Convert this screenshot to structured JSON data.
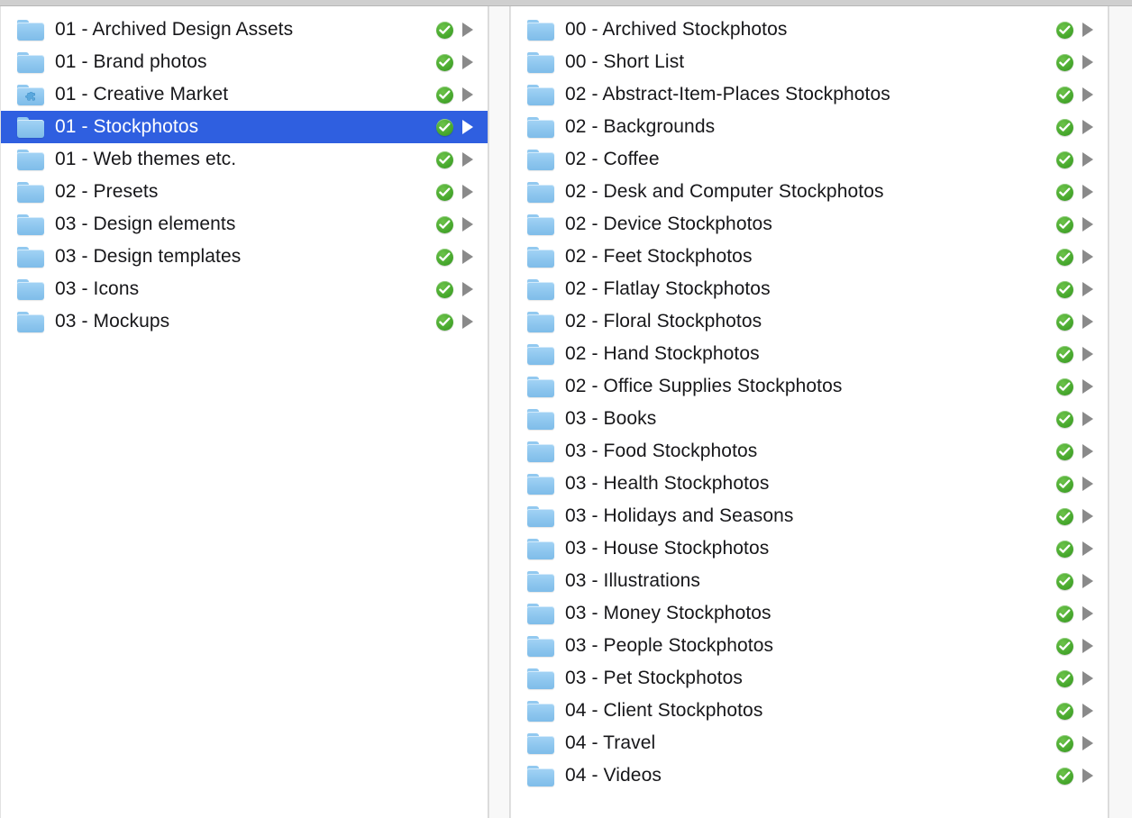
{
  "window": {
    "app": "Finder",
    "view_mode": "column-view",
    "accent_color": "#2f5fe0",
    "sync_badge_color": "#47a82d",
    "folder_color": "#8dc6ee",
    "text_color": "#17171a"
  },
  "icons": {
    "folder": "folder-icon",
    "folder_plugin": "folder-plugin-icon",
    "sync_ok": "dropbox-sync-check-icon",
    "disclosure": "disclosure-arrow-icon"
  },
  "columns": [
    {
      "name": "parent-column",
      "items": [
        {
          "label": "01 - Archived Design Assets",
          "icon": "folder",
          "synced": true,
          "has_children": true,
          "selected": false
        },
        {
          "label": "01 - Brand photos",
          "icon": "folder",
          "synced": true,
          "has_children": true,
          "selected": false
        },
        {
          "label": "01 - Creative Market",
          "icon": "folder-plugin",
          "synced": true,
          "has_children": true,
          "selected": false
        },
        {
          "label": "01 - Stockphotos",
          "icon": "folder",
          "synced": true,
          "has_children": true,
          "selected": true
        },
        {
          "label": "01 - Web themes etc.",
          "icon": "folder",
          "synced": true,
          "has_children": true,
          "selected": false
        },
        {
          "label": "02 - Presets",
          "icon": "folder",
          "synced": true,
          "has_children": true,
          "selected": false
        },
        {
          "label": "03 - Design elements",
          "icon": "folder",
          "synced": true,
          "has_children": true,
          "selected": false
        },
        {
          "label": "03 - Design templates",
          "icon": "folder",
          "synced": true,
          "has_children": true,
          "selected": false
        },
        {
          "label": "03 - Icons",
          "icon": "folder",
          "synced": true,
          "has_children": true,
          "selected": false
        },
        {
          "label": "03 - Mockups",
          "icon": "folder",
          "synced": true,
          "has_children": true,
          "selected": false
        }
      ]
    },
    {
      "name": "child-column",
      "items": [
        {
          "label": "00 - Archived Stockphotos",
          "icon": "folder",
          "synced": true,
          "has_children": true,
          "selected": false
        },
        {
          "label": "00 - Short List",
          "icon": "folder",
          "synced": true,
          "has_children": true,
          "selected": false
        },
        {
          "label": "02 - Abstract-Item-Places Stockphotos",
          "icon": "folder",
          "synced": true,
          "has_children": true,
          "selected": false
        },
        {
          "label": "02 - Backgrounds",
          "icon": "folder",
          "synced": true,
          "has_children": true,
          "selected": false
        },
        {
          "label": "02 - Coffee",
          "icon": "folder",
          "synced": true,
          "has_children": true,
          "selected": false
        },
        {
          "label": "02 - Desk and Computer Stockphotos",
          "icon": "folder",
          "synced": true,
          "has_children": true,
          "selected": false
        },
        {
          "label": "02 - Device Stockphotos",
          "icon": "folder",
          "synced": true,
          "has_children": true,
          "selected": false
        },
        {
          "label": "02 - Feet Stockphotos",
          "icon": "folder",
          "synced": true,
          "has_children": true,
          "selected": false
        },
        {
          "label": "02 - Flatlay Stockphotos",
          "icon": "folder",
          "synced": true,
          "has_children": true,
          "selected": false
        },
        {
          "label": "02 - Floral Stockphotos",
          "icon": "folder",
          "synced": true,
          "has_children": true,
          "selected": false
        },
        {
          "label": "02 - Hand Stockphotos",
          "icon": "folder",
          "synced": true,
          "has_children": true,
          "selected": false
        },
        {
          "label": "02 - Office Supplies Stockphotos",
          "icon": "folder",
          "synced": true,
          "has_children": true,
          "selected": false
        },
        {
          "label": "03 - Books",
          "icon": "folder",
          "synced": true,
          "has_children": true,
          "selected": false
        },
        {
          "label": "03 - Food Stockphotos",
          "icon": "folder",
          "synced": true,
          "has_children": true,
          "selected": false
        },
        {
          "label": "03 - Health Stockphotos",
          "icon": "folder",
          "synced": true,
          "has_children": true,
          "selected": false
        },
        {
          "label": "03 - Holidays and Seasons",
          "icon": "folder",
          "synced": true,
          "has_children": true,
          "selected": false
        },
        {
          "label": "03 - House Stockphotos",
          "icon": "folder",
          "synced": true,
          "has_children": true,
          "selected": false
        },
        {
          "label": "03 - Illustrations",
          "icon": "folder",
          "synced": true,
          "has_children": true,
          "selected": false
        },
        {
          "label": "03 - Money Stockphotos",
          "icon": "folder",
          "synced": true,
          "has_children": true,
          "selected": false
        },
        {
          "label": "03 - People Stockphotos",
          "icon": "folder",
          "synced": true,
          "has_children": true,
          "selected": false
        },
        {
          "label": "03 - Pet Stockphotos",
          "icon": "folder",
          "synced": true,
          "has_children": true,
          "selected": false
        },
        {
          "label": "04 - Client Stockphotos",
          "icon": "folder",
          "synced": true,
          "has_children": true,
          "selected": false
        },
        {
          "label": "04 - Travel",
          "icon": "folder",
          "synced": true,
          "has_children": true,
          "selected": false
        },
        {
          "label": "04 - Videos",
          "icon": "folder",
          "synced": true,
          "has_children": true,
          "selected": false
        }
      ]
    }
  ]
}
